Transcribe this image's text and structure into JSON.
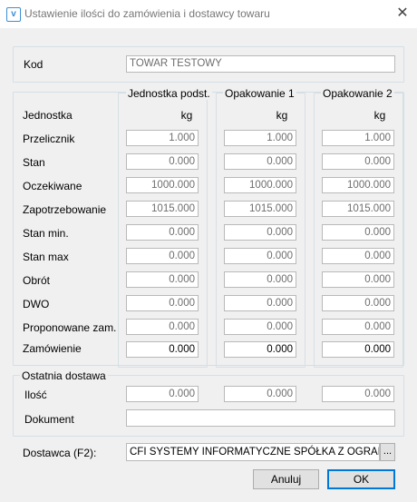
{
  "window": {
    "title": "Ustawienie ilości do zamówienia i dostawcy towaru",
    "icon": "v",
    "close_glyph": "✕"
  },
  "kod": {
    "label": "Kod",
    "value": "TOWAR TESTOWY"
  },
  "columns": [
    "Jednostka podst.",
    "Opakowanie 1",
    "Opakowanie 2"
  ],
  "units": [
    "kg",
    "kg",
    "kg"
  ],
  "jednostka_label": "Jednostka",
  "rows": [
    {
      "label": "Przelicznik",
      "values": [
        "1.000",
        "1.000",
        "1.000"
      ]
    },
    {
      "label": "Stan",
      "values": [
        "0.000",
        "0.000",
        "0.000"
      ]
    },
    {
      "label": "Oczekiwane",
      "values": [
        "1000.000",
        "1000.000",
        "1000.000"
      ]
    },
    {
      "label": "Zapotrzebowanie",
      "values": [
        "1015.000",
        "1015.000",
        "1015.000"
      ]
    },
    {
      "label": "Stan min.",
      "values": [
        "0.000",
        "0.000",
        "0.000"
      ]
    },
    {
      "label": "Stan max",
      "values": [
        "0.000",
        "0.000",
        "0.000"
      ]
    },
    {
      "label": "Obrót",
      "values": [
        "0.000",
        "0.000",
        "0.000"
      ]
    },
    {
      "label": "DWO",
      "values": [
        "0.000",
        "0.000",
        "0.000"
      ]
    },
    {
      "label": "Proponowane zam.",
      "values": [
        "0.000",
        "0.000",
        "0.000"
      ]
    },
    {
      "label": "Zamówienie",
      "values": [
        "0.000",
        "0.000",
        "0.000"
      ]
    }
  ],
  "ostatnia_dostawa": {
    "title": "Ostatnia dostawa",
    "ilosc_label": "Ilość",
    "ilosc_values": [
      "0.000",
      "0.000",
      "0.000"
    ],
    "dokument_label": "Dokument",
    "dokument_value": ""
  },
  "dostawca": {
    "label": "Dostawca (F2):",
    "value": "CFI SYSTEMY INFORMATYCZNE SPÓŁKA Z OGRANIC...",
    "browse": "..."
  },
  "buttons": {
    "cancel": "Anuluj",
    "ok": "OK"
  }
}
